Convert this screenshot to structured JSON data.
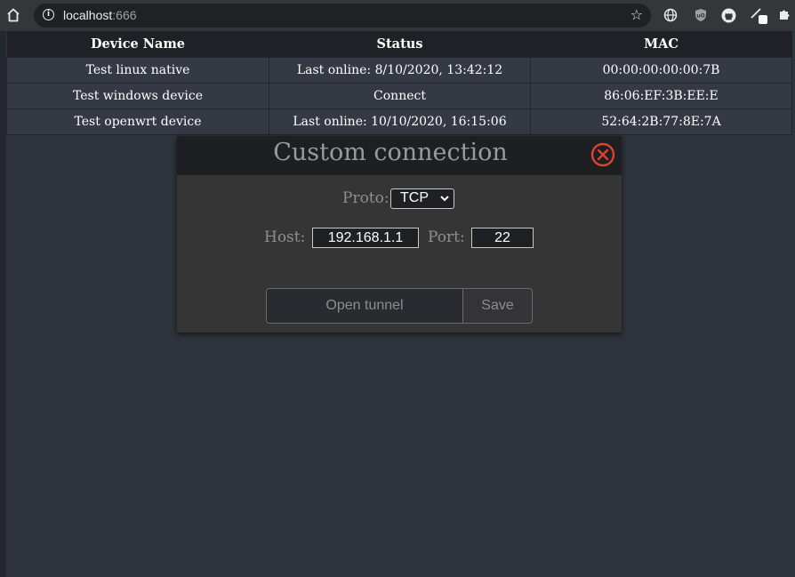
{
  "browser": {
    "url_host": "localhost",
    "url_port": ":666"
  },
  "table": {
    "headers": [
      "Device Name",
      "Status",
      "MAC"
    ],
    "rows": [
      {
        "name": "Test linux native",
        "status": "Last online: 8/10/2020, 13:42:12",
        "mac": "00:00:00:00:00:7B"
      },
      {
        "name": "Test windows device",
        "status": "Connect",
        "mac": "86:06:EF:3B:EE:E"
      },
      {
        "name": "Test openwrt device",
        "status": "Last online: 10/10/2020, 16:15:06",
        "mac": "52:64:2B:77:8E:7A"
      }
    ]
  },
  "modal": {
    "title": "Custom connection",
    "proto_label": "Proto:",
    "proto_value": "TCP",
    "host_label": "Host:",
    "host_value": "192.168.1.1",
    "port_label": "Port:",
    "port_value": "22",
    "open_tunnel_label": "Open tunnel",
    "save_label": "Save"
  },
  "colors": {
    "page_bg": "#2f333c",
    "close_icon": "#d9442f"
  },
  "icons": {
    "browser": [
      "home-icon",
      "info-icon",
      "star-icon",
      "globe-icon",
      "ublock-icon",
      "github-icon",
      "pen-extension-icon",
      "puzzle-extensions-icon"
    ],
    "modal": [
      "close-icon"
    ]
  }
}
